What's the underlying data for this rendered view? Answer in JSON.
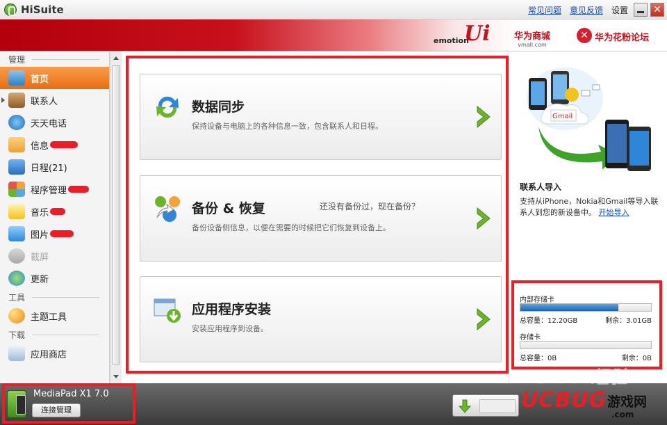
{
  "titlebar": {
    "app_name": "HiSuite",
    "faq": "常见问题",
    "feedback": "意见反馈",
    "settings": "设置"
  },
  "banner": {
    "emotion": "emotion",
    "ui": "Ui",
    "vmall": "华为商城",
    "vmall_sub": "vmall.com",
    "forum": "华为花粉论坛"
  },
  "sidebar": {
    "sections": [
      "管理",
      "工具",
      "下载"
    ],
    "manage_items": [
      {
        "label": "首页"
      },
      {
        "label": "联系人"
      },
      {
        "label": "天天电话"
      },
      {
        "label": "信息"
      },
      {
        "label": "日程(21)"
      },
      {
        "label": "程序管理"
      },
      {
        "label": "音乐"
      },
      {
        "label": "图片"
      },
      {
        "label": "截屏"
      },
      {
        "label": "更新"
      }
    ],
    "tool_items": [
      {
        "label": "主题工具"
      }
    ],
    "download_items": [
      {
        "label": "应用商店"
      }
    ]
  },
  "cards": [
    {
      "title": "数据同步",
      "desc": "保持设备与电脑上的各种信息一致，包含联系人和日程。"
    },
    {
      "title": "备份 & 恢复",
      "desc": "备份设备侧信息，以便在需要的时候把它们恢复到设备上。",
      "hint": "还没有备份过，现在备份？"
    },
    {
      "title": "应用程序安装",
      "desc": "安装应用程序到设备。"
    }
  ],
  "promo": {
    "gmail": "Gmail",
    "title": "联系人导入",
    "text": "支持从iPhone，Nokia和Gmail等导入联系人到您的新设备中。",
    "link": "开始导入"
  },
  "storage": {
    "internal": {
      "label": "内部存储卡",
      "total": "总容量：12.20GB",
      "free": "剩余：3.01GB",
      "used_fraction": 0.75
    },
    "card": {
      "label": "存储卡",
      "total": "总容量：0B",
      "free": "剩余：0B",
      "used_fraction": 0
    }
  },
  "device": {
    "name": "MediaPad X1 7.0",
    "connect_label": "连接管理"
  },
  "watermarks": {
    "baidu": "Baidu 经验",
    "ucbug": "UCBUG",
    "game": "游戏网",
    "com": ".com"
  },
  "colors": {
    "accent_orange": "#e96d0f",
    "highlight_red": "#ee1c24",
    "link_blue": "#1a4fb5",
    "arrow_green": "#6cb52a"
  }
}
